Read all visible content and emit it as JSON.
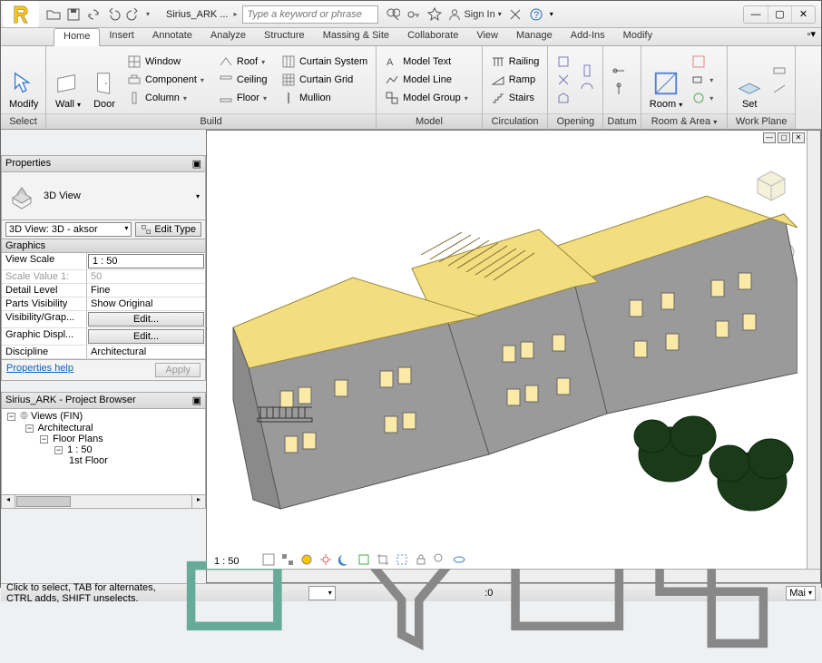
{
  "title": "Sirius_ARK ...",
  "search_placeholder": "Type a keyword or phrase",
  "signin": "Sign In",
  "tabs": [
    "Home",
    "Insert",
    "Annotate",
    "Analyze",
    "Structure",
    "Massing & Site",
    "Collaborate",
    "View",
    "Manage",
    "Add-Ins",
    "Modify"
  ],
  "active_tab": 0,
  "ribbon": {
    "select": {
      "label": "Select",
      "btn": "Modify"
    },
    "build": {
      "label": "Build",
      "wall": "Wall",
      "door": "Door",
      "row1": [
        "Window",
        "Component",
        "Column"
      ],
      "row2": [
        "Roof",
        "Ceiling",
        "Floor"
      ],
      "row3": [
        "Curtain System",
        "Curtain Grid",
        "Mullion"
      ]
    },
    "model": {
      "label": "Model",
      "rows": [
        "Model Text",
        "Model Line",
        "Model Group"
      ]
    },
    "circ": {
      "label": "Circulation",
      "rows": [
        "Railing",
        "Ramp",
        "Stairs"
      ]
    },
    "opening": {
      "label": "Opening"
    },
    "datum": {
      "label": "Datum"
    },
    "roomarea": {
      "label": "Room & Area",
      "btn": "Room"
    },
    "workplane": {
      "label": "Work Plane",
      "btn": "Set"
    }
  },
  "properties": {
    "title": "Properties",
    "view_type": "3D View",
    "instance": "3D View: 3D - aksor",
    "edit_type": "Edit Type",
    "cat": "Graphics",
    "rows": [
      {
        "k": "View Scale",
        "v": "1 : 50"
      },
      {
        "k": "Scale Value   1:",
        "v": "50",
        "dim": true
      },
      {
        "k": "Detail Level",
        "v": "Fine"
      },
      {
        "k": "Parts Visibility",
        "v": "Show Original"
      },
      {
        "k": "Visibility/Grap...",
        "v": "Edit...",
        "btn": true
      },
      {
        "k": "Graphic Displ...",
        "v": "Edit...",
        "btn": true
      },
      {
        "k": "Discipline",
        "v": "Architectural"
      }
    ],
    "help": "Properties help",
    "apply": "Apply"
  },
  "browser": {
    "title": "Sirius_ARK - Project Browser",
    "items": [
      "Views (FIN)",
      "Architectural",
      "Floor Plans",
      "1 : 50",
      "1st Floor"
    ]
  },
  "viewport": {
    "scale": "1 : 50"
  },
  "status": {
    "msg": "Click to select, TAB for alternates, CTRL adds, SHIFT unselects.",
    "filter": ":0",
    "lang": "Mai"
  }
}
